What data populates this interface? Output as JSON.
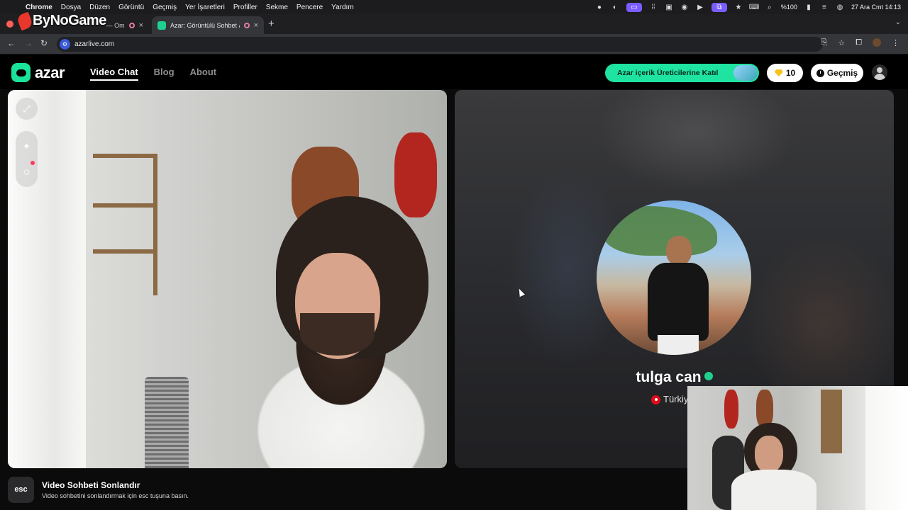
{
  "menubar": {
    "app": "Chrome",
    "items": [
      "Dosya",
      "Düzen",
      "Görüntü",
      "Geçmiş",
      "Yer İşaretleri",
      "Profiller",
      "Sekme",
      "Pencere",
      "Yardım"
    ],
    "battery": "%100",
    "datetime": "27 Ara Cmt  14:13"
  },
  "watermark": "ByNoGame",
  "tabs": [
    {
      "title": "— Om",
      "recording": true,
      "close": "×"
    },
    {
      "title": "Azar: Görüntülü Sohbet &",
      "recording": true,
      "close": "×"
    }
  ],
  "new_tab": "+",
  "address": {
    "url": "azarlive.com"
  },
  "azar": {
    "logo": "azar",
    "nav": [
      {
        "label": "Video Chat",
        "active": true
      },
      {
        "label": "Blog",
        "active": false
      },
      {
        "label": "About",
        "active": false
      }
    ],
    "creator_button": "Azar içerik Üreticilerine Katıl",
    "gems": "10",
    "history_button": "Geçmiş"
  },
  "match": {
    "name": "tulga can",
    "country": "Türkiy"
  },
  "hint": {
    "key": "esc",
    "title": "Video Sohbeti Sonlandır",
    "subtitle": "Video sohbetini sonlandırmak için esc tuşuna basın."
  },
  "colors": {
    "accent": "#1fe3a0",
    "background": "#000000",
    "record_badge": "#e57aa0"
  },
  "icons": [
    "apple-icon",
    "search-icon",
    "star-icon",
    "wifi-icon",
    "back-arrow-icon",
    "forward-arrow-icon",
    "reload-icon",
    "bookmark-star-icon",
    "extensions-icon",
    "sparkle-icon",
    "emoji-icon",
    "expand-icon",
    "gem-icon",
    "clock-icon",
    "user-icon"
  ]
}
